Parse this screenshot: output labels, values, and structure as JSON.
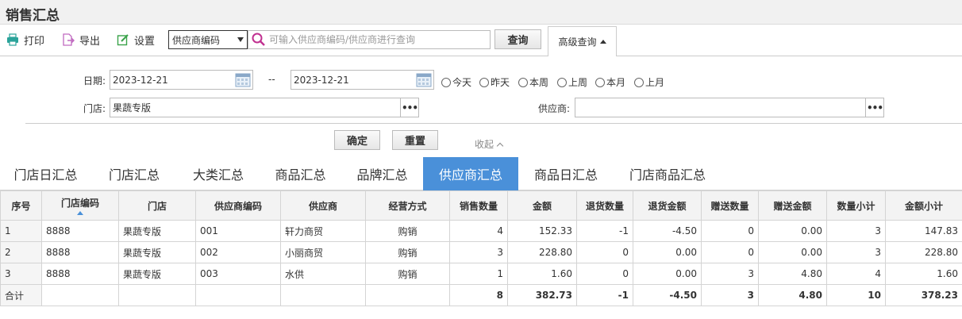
{
  "page": {
    "title": "销售汇总"
  },
  "toolbar": {
    "print_label": "打印",
    "export_label": "导出",
    "settings_label": "设置",
    "search_field_selected": "供应商编码",
    "search_placeholder": "可输入供应商编码/供应商进行查询",
    "query_label": "查询",
    "advanced_label": "高级查询"
  },
  "filters": {
    "date_label": "日期:",
    "date_from": "2023-12-21",
    "date_sep": "--",
    "date_to": "2023-12-21",
    "quick_dates": [
      "今天",
      "昨天",
      "本周",
      "上周",
      "本月",
      "上月"
    ],
    "store_label": "门店:",
    "store_value": "果蔬专版",
    "supplier_label": "供应商:",
    "supplier_value": "",
    "more_label": "•••",
    "confirm_label": "确定",
    "reset_label": "重置",
    "collapse_label": "收起"
  },
  "tabs": [
    "门店日汇总",
    "门店汇总",
    "大类汇总",
    "商品汇总",
    "品牌汇总",
    "供应商汇总",
    "商品日汇总",
    "门店商品汇总"
  ],
  "active_tab": "供应商汇总",
  "table": {
    "columns": [
      "序号",
      "门店编码",
      "门店",
      "供应商编码",
      "供应商",
      "经营方式",
      "销售数量",
      "金额",
      "退货数量",
      "退货金额",
      "赠送数量",
      "赠送金额",
      "数量小计",
      "金额小计"
    ],
    "rows": [
      [
        "1",
        "8888",
        "果蔬专版",
        "001",
        "轩力商贸",
        "购销",
        "4",
        "152.33",
        "-1",
        "-4.50",
        "0",
        "0.00",
        "3",
        "147.83"
      ],
      [
        "2",
        "8888",
        "果蔬专版",
        "002",
        "小丽商贸",
        "购销",
        "3",
        "228.80",
        "0",
        "0.00",
        "0",
        "0.00",
        "3",
        "228.80"
      ],
      [
        "3",
        "8888",
        "果蔬专版",
        "003",
        "水供",
        "购销",
        "1",
        "1.60",
        "0",
        "0.00",
        "3",
        "4.80",
        "4",
        "1.60"
      ]
    ],
    "total": [
      "合计",
      "",
      "",
      "",
      "",
      "",
      "8",
      "382.73",
      "-1",
      "-4.50",
      "3",
      "4.80",
      "10",
      "378.23"
    ]
  },
  "colors": {
    "accent": "#4a90d9",
    "header_bg": "#f3f3f3",
    "border": "#d4d4d4"
  }
}
